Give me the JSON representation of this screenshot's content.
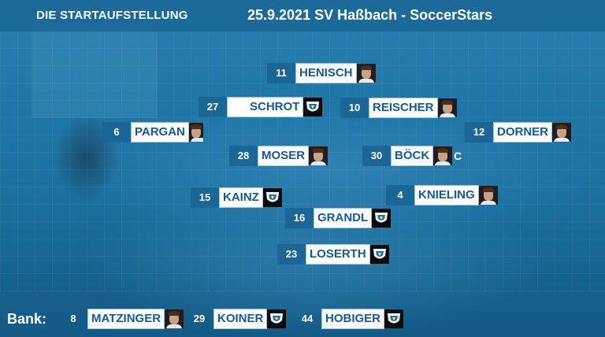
{
  "header": {
    "title_left": "DIE STARTAUFSTELLUNG",
    "title_right": "25.9.2021 SV Haßbach - SoccerStars"
  },
  "lineup": [
    {
      "number": "11",
      "name": "HENISCH",
      "avatar": "player-photo"
    },
    {
      "number": "27",
      "name": "SCHROT",
      "avatar": "club-crest"
    },
    {
      "number": "10",
      "name": "REISCHER",
      "avatar": "player-photo"
    },
    {
      "number": "6",
      "name": "PARGAN",
      "avatar": "player-photo"
    },
    {
      "number": "12",
      "name": "DORNER",
      "avatar": "player-photo"
    },
    {
      "number": "28",
      "name": "MOSER",
      "avatar": "player-photo"
    },
    {
      "number": "30",
      "name": "BÖCK",
      "avatar": "player-photo",
      "badge": "C"
    },
    {
      "number": "15",
      "name": "KAINZ",
      "avatar": "club-crest"
    },
    {
      "number": "4",
      "name": "KNIELING",
      "avatar": "player-photo"
    },
    {
      "number": "16",
      "name": "GRANDL",
      "avatar": "club-crest"
    },
    {
      "number": "23",
      "name": "LOSERTH",
      "avatar": "club-crest"
    }
  ],
  "bench": {
    "label": "Bank:",
    "players": [
      {
        "number": "8",
        "name": "MATZINGER",
        "avatar": "player-photo"
      },
      {
        "number": "29",
        "name": "KOINER",
        "avatar": "club-crest"
      },
      {
        "number": "44",
        "name": "HOBIGER",
        "avatar": "club-crest"
      }
    ]
  },
  "colors": {
    "background": "#1f77a8",
    "name_text": "#1459a0",
    "number_box": "#1a6696"
  }
}
